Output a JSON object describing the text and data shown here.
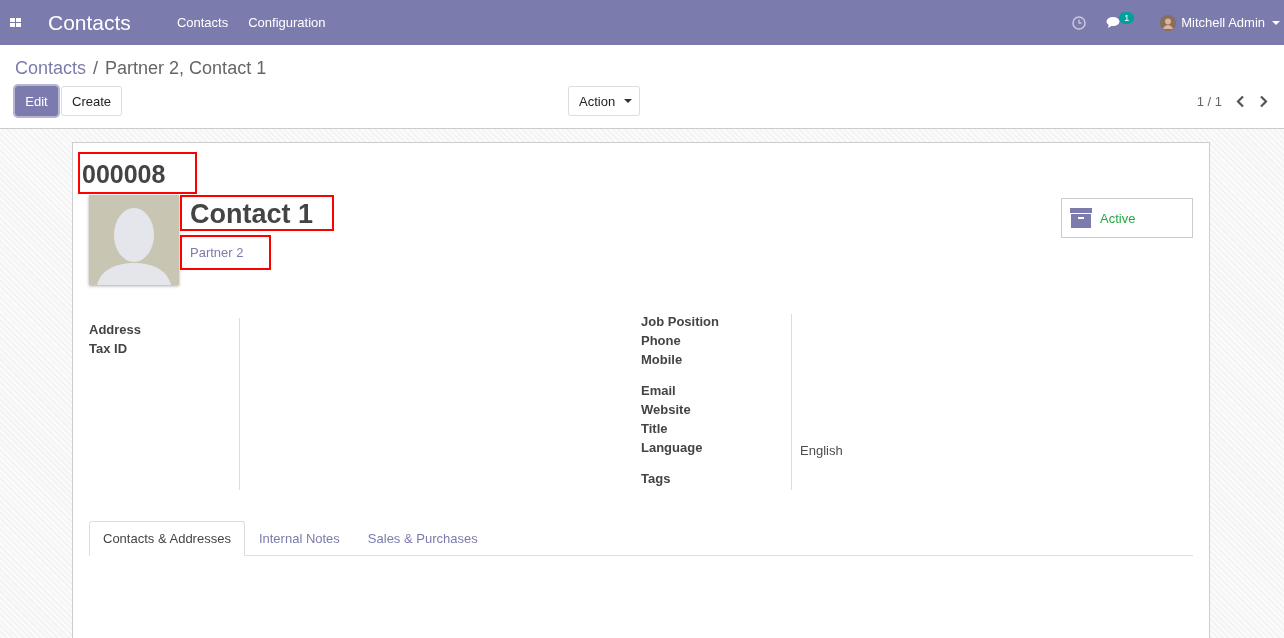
{
  "navbar": {
    "app_title": "Contacts",
    "menus": [
      "Contacts",
      "Configuration"
    ],
    "chat_count": "1",
    "user": "Mitchell Admin"
  },
  "breadcrumb": {
    "parent": "Contacts",
    "separator": "/",
    "current": "Partner 2, Contact 1"
  },
  "buttons": [
    {
      "label": "Edit",
      "kind": "primary"
    },
    {
      "label": "Create",
      "kind": "secondary"
    }
  ],
  "action": {
    "label": "Action"
  },
  "pager": {
    "value": "1 / 1"
  },
  "record": {
    "reference": "000008",
    "name": "Contact 1",
    "company": "Partner 2",
    "status": "Active",
    "highlighted": true
  },
  "left_fields": [
    {
      "label": "Address"
    },
    {
      "label": "Tax ID"
    }
  ],
  "right_fields": [
    {
      "label": "Job Position",
      "kind": "line"
    },
    {
      "label": "Phone",
      "kind": "line"
    },
    {
      "label": "Mobile",
      "kind": "box"
    },
    {
      "label": "Email",
      "kind": "line"
    },
    {
      "label": "Website",
      "kind": "line"
    },
    {
      "label": "Title",
      "kind": "line"
    },
    {
      "label": "Language",
      "kind": "box",
      "value": "English"
    },
    {
      "label": "Tags",
      "kind": "line"
    }
  ],
  "tabs": [
    {
      "label": "Contacts & Addresses",
      "selected": true
    },
    {
      "label": "Internal Notes",
      "selected": false
    },
    {
      "label": "Sales & Purchases",
      "selected": false
    }
  ]
}
